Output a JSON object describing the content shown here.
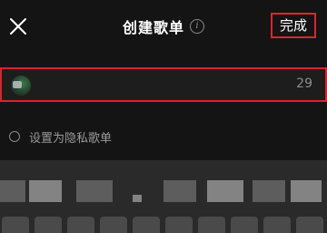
{
  "header": {
    "title": "创建歌单",
    "info_icon": "info-icon",
    "close_icon": "close-icon",
    "done_label": "完成"
  },
  "playlist_name": {
    "value": "",
    "char_count": "29"
  },
  "private_option": {
    "label": "设置为隐私歌单",
    "checked": false
  },
  "colors": {
    "background": "#141414",
    "highlight_border": "#e0242c",
    "text_primary": "#ffffff",
    "text_secondary": "#9a9a9a"
  }
}
